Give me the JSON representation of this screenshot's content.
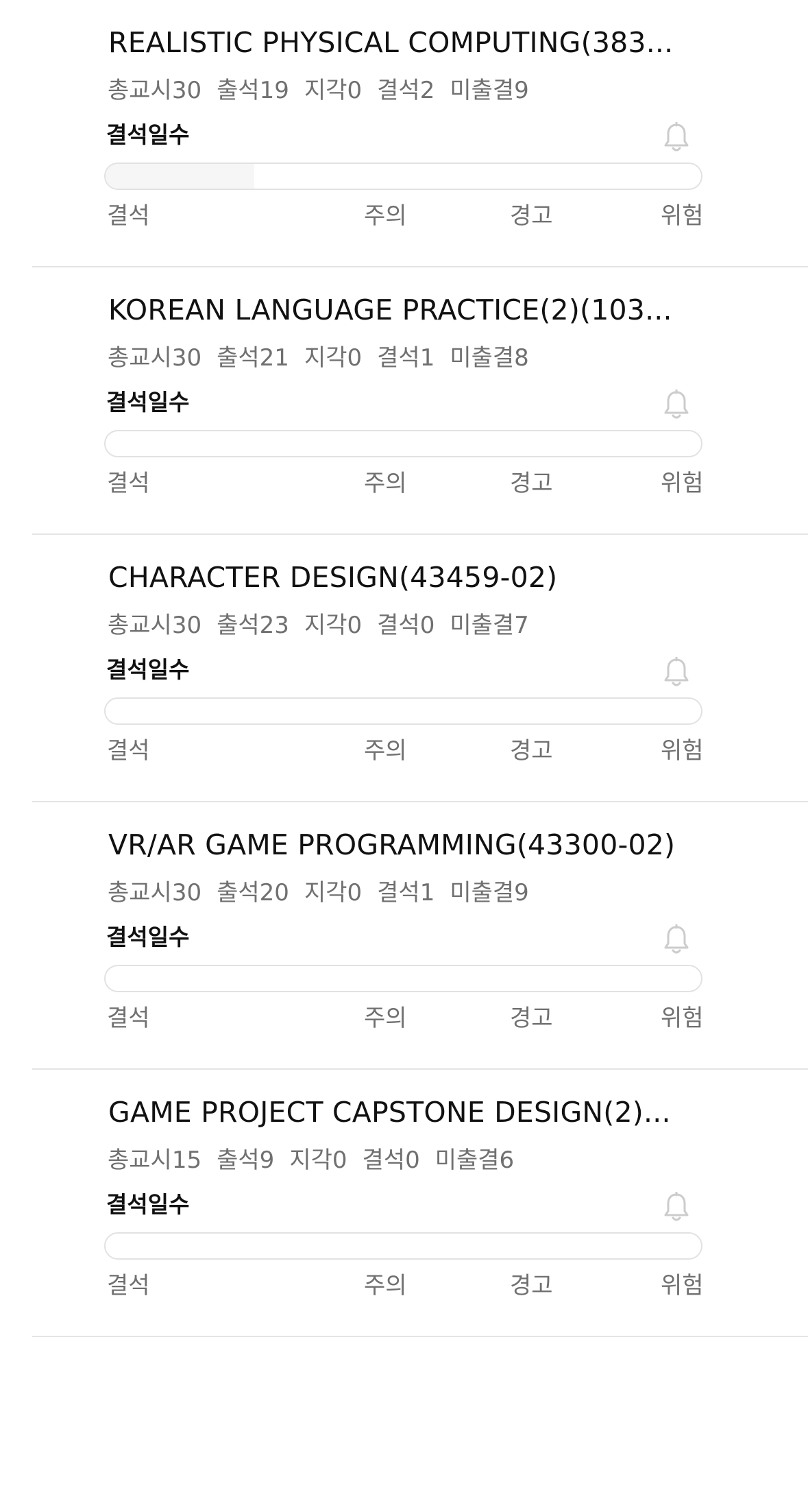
{
  "labels": {
    "absence_days": "결석일수",
    "scale_absent": "결석",
    "scale_caution": "주의",
    "scale_warning": "경고",
    "scale_danger": "위험"
  },
  "colors": {
    "divider": "#e4e4e4",
    "bar_border": "#e2e2e2",
    "bar_fill": "#f6f6f6",
    "muted_text": "#707070",
    "bell_icon": "#cccccc"
  },
  "courses": [
    {
      "title": "REALISTIC PHYSICAL COMPUTING(383...",
      "stats": {
        "total": "총교시30",
        "attended": "출석19",
        "late": "지각0",
        "absent": "결석2",
        "unrecorded": "미출결9"
      },
      "absence_progress": 0.25,
      "bell_icon": "bell-icon"
    },
    {
      "title": "KOREAN LANGUAGE PRACTICE(2)(103...",
      "stats": {
        "total": "총교시30",
        "attended": "출석21",
        "late": "지각0",
        "absent": "결석1",
        "unrecorded": "미출결8"
      },
      "absence_progress": 0,
      "bell_icon": "bell-icon"
    },
    {
      "title": "CHARACTER DESIGN(43459-02)",
      "stats": {
        "total": "총교시30",
        "attended": "출석23",
        "late": "지각0",
        "absent": "결석0",
        "unrecorded": "미출결7"
      },
      "absence_progress": 0,
      "bell_icon": "bell-icon"
    },
    {
      "title": "VR/AR GAME PROGRAMMING(43300-02)",
      "stats": {
        "total": "총교시30",
        "attended": "출석20",
        "late": "지각0",
        "absent": "결석1",
        "unrecorded": "미출결9"
      },
      "absence_progress": 0,
      "bell_icon": "bell-icon"
    },
    {
      "title": "GAME PROJECT CAPSTONE DESIGN(2)...",
      "stats": {
        "total": "총교시15",
        "attended": "출석9",
        "late": "지각0",
        "absent": "결석0",
        "unrecorded": "미출결6"
      },
      "absence_progress": 0,
      "bell_icon": "bell-icon"
    }
  ]
}
